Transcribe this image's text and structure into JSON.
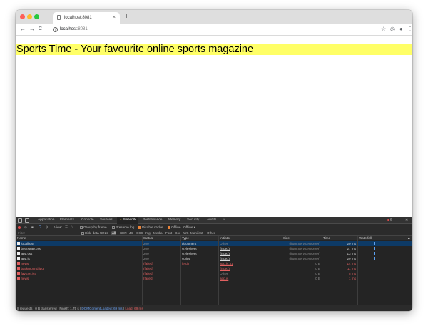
{
  "browser": {
    "tab_title": "localhost:8081",
    "tab_close": "×",
    "new_tab": "+",
    "back": "←",
    "forward": "→",
    "reload": "C",
    "url_host": "localhost",
    "url_port": ":8081",
    "info_glyph": "i",
    "star": "☆",
    "extension": "◎",
    "profile": "●",
    "menu": "⋮"
  },
  "page": {
    "heading": "Sports Time - Your favourite online sports magazine",
    "banner_color": "#ffff66"
  },
  "devtools": {
    "tabs": [
      "Application",
      "Elements",
      "Console",
      "Sources",
      "Network",
      "Performance",
      "Memory",
      "Security",
      "Audits"
    ],
    "active_tab": "Network",
    "active_glyph": "▲",
    "more_tabs": "»",
    "error_count": "6",
    "more_menu": "⋮",
    "close": "✕",
    "toolbar": {
      "view_label": "View:",
      "group_by_frame": "Group by frame",
      "preserve_log": "Preserve log",
      "disable_cache": "Disable cache",
      "offline_check": "Offline",
      "throttle": "Offline",
      "throttle_arrow": "▾"
    },
    "filter": {
      "placeholder": "Filter",
      "hide_data_urls": "Hide data URLs",
      "types": [
        "All",
        "XHR",
        "JS",
        "CSS",
        "Img",
        "Media",
        "Font",
        "Doc",
        "WS",
        "Manifest",
        "Other"
      ],
      "selected_type": "All"
    },
    "columns": [
      "Name",
      "Status",
      "Type",
      "Initiator",
      "Size",
      "Time",
      "Waterfall"
    ],
    "sort_glyph": "▲",
    "rows": [
      {
        "name": "localhost",
        "status": "200",
        "type": "document",
        "initiator": "Other",
        "size": "(from ServiceWorker)",
        "time": "20 ms",
        "failed": false,
        "selected": true
      },
      {
        "name": "bootstrap.css",
        "status": "200",
        "type": "stylesheet",
        "initiator": "(index)",
        "size": "(from ServiceWorker)",
        "time": "27 ms",
        "failed": false,
        "selected": false
      },
      {
        "name": "app.css",
        "status": "200",
        "type": "stylesheet",
        "initiator": "(index)",
        "size": "(from ServiceWorker)",
        "time": "13 ms",
        "failed": false,
        "selected": false
      },
      {
        "name": "app.js",
        "status": "200",
        "type": "script",
        "initiator": "(index)",
        "size": "(from ServiceWorker)",
        "time": "29 ms",
        "failed": false,
        "selected": false
      },
      {
        "name": "news",
        "status": "(failed)",
        "type": "fetch",
        "initiator": "app.js:31",
        "size": "0 B",
        "time": "14 ms",
        "failed": true,
        "selected": false
      },
      {
        "name": "background.jpg",
        "status": "(failed)",
        "type": "",
        "initiator": "(index)",
        "size": "0 B",
        "time": "11 ms",
        "failed": true,
        "selected": false
      },
      {
        "name": "favicon.ico",
        "status": "(failed)",
        "type": "",
        "initiator": "Other",
        "size": "0 B",
        "time": "5 ms",
        "failed": true,
        "selected": false
      },
      {
        "name": "news",
        "status": "(failed)",
        "type": "",
        "initiator": "app.js",
        "size": "0 B",
        "time": "1 ms",
        "failed": true,
        "selected": false
      }
    ],
    "status_bar": {
      "summary": "8 requests | 0 B transferred | Finish: 1.75 s |",
      "dom_content_loaded": "DOMContentLoaded: 69 ms",
      "separator": "|",
      "load": "Load: 69 ms"
    }
  }
}
